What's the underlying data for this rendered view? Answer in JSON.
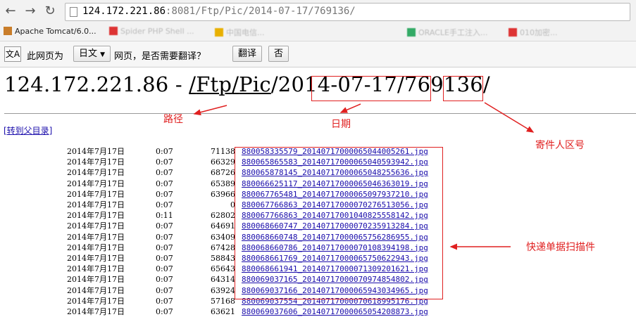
{
  "browser": {
    "url_host": "124.172.221.86",
    "url_rest": ":8081/Ftp/Pic/2014-07-17/769136/",
    "bookmarks": [
      {
        "label": "Apache Tomcat/6.0...",
        "clear": true
      },
      {
        "label": "Spider PHP Shell ...",
        "clear": false
      },
      {
        "label": "中国电信...",
        "clear": false
      },
      {
        "label": "ORACLE手工注入...",
        "clear": false
      },
      {
        "label": "010加密...",
        "clear": false
      }
    ]
  },
  "translate_bar": {
    "prompt_prefix": "此网页为",
    "language": "日文",
    "prompt_suffix": "网页，是否需要翻译？",
    "translate_button": "翻译",
    "no_button": "否"
  },
  "page": {
    "heading_host": "124.172.221.86 - ",
    "heading_path": [
      {
        "text": "/",
        "link": true
      },
      {
        "text": "Ftp",
        "link": true
      },
      {
        "text": "/",
        "link": true
      },
      {
        "text": "Pic",
        "link": true
      },
      {
        "text": "/",
        "link": false
      },
      {
        "text": "2014-07-17",
        "link": false
      },
      {
        "text": "/",
        "link": false
      },
      {
        "text": "769136",
        "link": false
      },
      {
        "text": "/",
        "link": false
      }
    ],
    "parent_link": "[转到父目录]",
    "files": [
      {
        "date": "2014年7月17日",
        "time": "0:07",
        "size": "71138",
        "name": "880058335579_20140717000065044005261.jpg"
      },
      {
        "date": "2014年7月17日",
        "time": "0:07",
        "size": "66329",
        "name": "880065865583_20140717000065040593942.jpg"
      },
      {
        "date": "2014年7月17日",
        "time": "0:07",
        "size": "68726",
        "name": "880065878145_20140717000065048255636.jpg"
      },
      {
        "date": "2014年7月17日",
        "time": "0:07",
        "size": "65389",
        "name": "880066625117_20140717000065046363019.jpg"
      },
      {
        "date": "2014年7月17日",
        "time": "0:07",
        "size": "63966",
        "name": "880067765481_20140717000065097937210.jpg"
      },
      {
        "date": "2014年7月17日",
        "time": "0:07",
        "size": "0",
        "name": "880067766863_20140717000070276513056.jpg"
      },
      {
        "date": "2014年7月17日",
        "time": "0:11",
        "size": "62802",
        "name": "880067766863_20140717001040825558142.jpg"
      },
      {
        "date": "2014年7月17日",
        "time": "0:07",
        "size": "64691",
        "name": "880068660747_20140717000070235913284.jpg"
      },
      {
        "date": "2014年7月17日",
        "time": "0:07",
        "size": "63409",
        "name": "880068660748_20140717000065756286955.jpg"
      },
      {
        "date": "2014年7月17日",
        "time": "0:07",
        "size": "67428",
        "name": "880068660786_20140717000070108394198.jpg"
      },
      {
        "date": "2014年7月17日",
        "time": "0:07",
        "size": "58843",
        "name": "880068661769_20140717000065750622943.jpg"
      },
      {
        "date": "2014年7月17日",
        "time": "0:07",
        "size": "65643",
        "name": "880068661941_20140717000071309201621.jpg"
      },
      {
        "date": "2014年7月17日",
        "time": "0:07",
        "size": "64314",
        "name": "880069037165_20140717000070974854802.jpg"
      },
      {
        "date": "2014年7月17日",
        "time": "0:07",
        "size": "63924",
        "name": "880069037166_20140717000065943034965.jpg"
      },
      {
        "date": "2014年7月17日",
        "time": "0:07",
        "size": "57168",
        "name": "880069037554_20140717000070618995176.jpg"
      },
      {
        "date": "2014年7月17日",
        "time": "0:07",
        "size": "63621",
        "name": "880069037606_20140717000065054208873.jpg"
      }
    ]
  },
  "annotations": {
    "path_label": "路径",
    "date_label": "日期",
    "sender_label": "寄件人区号",
    "scan_label": "快递单据扫描件",
    "color": "#e02020"
  }
}
